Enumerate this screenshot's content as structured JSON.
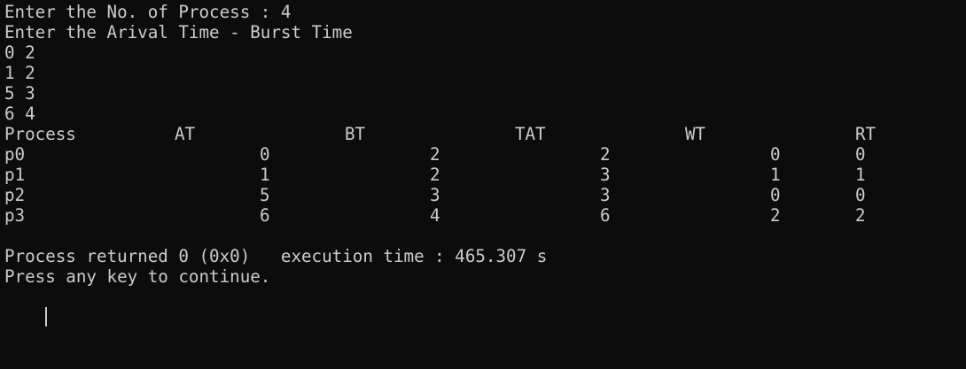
{
  "console": {
    "prompt_count": "Enter the No. of Process : 4",
    "prompt_times": "Enter the Arival Time - Burst Time",
    "inputs": [
      "0 2",
      "1 2",
      "5 3",
      "6 4"
    ],
    "table": {
      "headers": [
        "Process",
        "AT",
        "BT",
        "TAT",
        "WT",
        "RT"
      ],
      "rows": [
        [
          "p0",
          "0",
          "2",
          "2",
          "0",
          "0"
        ],
        [
          "p1",
          "1",
          "2",
          "3",
          "1",
          "1"
        ],
        [
          "p2",
          "5",
          "3",
          "3",
          "0",
          "0"
        ],
        [
          "p3",
          "6",
          "4",
          "6",
          "2",
          "2"
        ]
      ]
    },
    "status_line": "Process returned 0 (0x0)   execution time : 465.307 s",
    "continue_line": "Press any key to continue."
  },
  "colors": {
    "background": "#0c0c0c",
    "text": "#cccccc"
  }
}
